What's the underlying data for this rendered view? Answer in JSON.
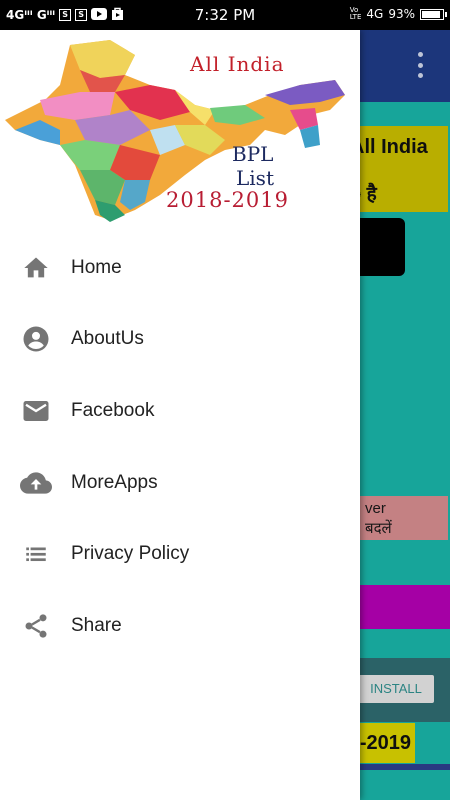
{
  "status_bar": {
    "left_text": "4Gᴵᴵᴵ Gᴵᴵᴵ",
    "time": "7:32 PM",
    "network": "4G",
    "battery": "93%"
  },
  "background_app": {
    "title_line1": "All India",
    "title_line2": "े है",
    "pink_line1": "ver",
    "pink_line2": "बदलें",
    "install_label": "INSTALL",
    "year_text": "-2019"
  },
  "drawer": {
    "header": {
      "title": "All India",
      "bpl": "BPL",
      "list": "List",
      "year": "2018-2019"
    },
    "items": [
      {
        "label": "Home",
        "icon": "home-icon"
      },
      {
        "label": "AboutUs",
        "icon": "account-circle-icon"
      },
      {
        "label": "Facebook",
        "icon": "mail-icon"
      },
      {
        "label": "MoreApps",
        "icon": "cloud-upload-icon"
      },
      {
        "label": "Privacy Policy",
        "icon": "list-icon"
      },
      {
        "label": "Share",
        "icon": "share-icon"
      }
    ]
  },
  "colors": {
    "toolbar": "#1f3b86",
    "background": "#19b3a8",
    "icon": "#757575"
  }
}
